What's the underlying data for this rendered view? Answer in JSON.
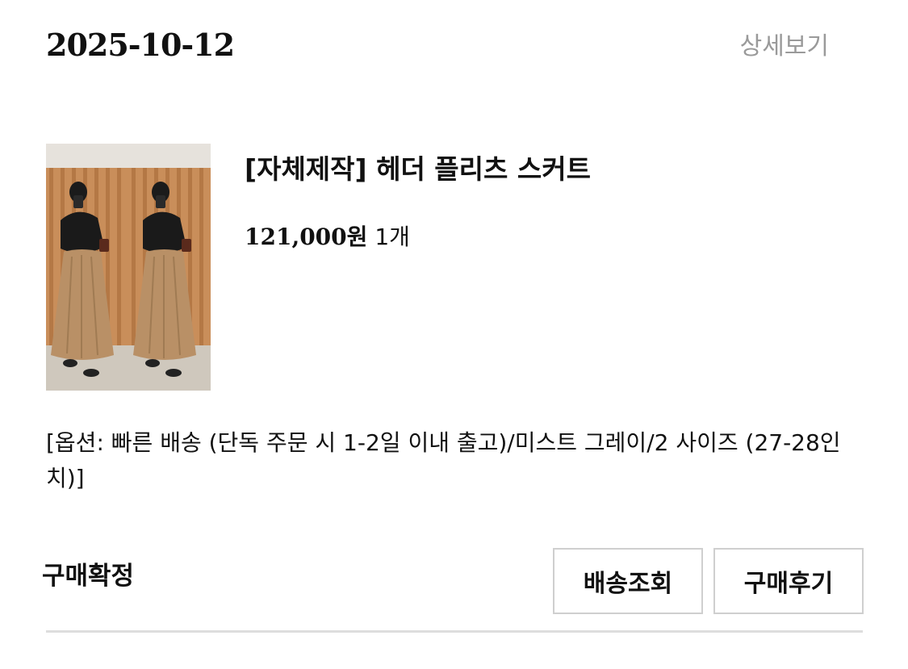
{
  "order": {
    "date": "2025-10-12",
    "detail_link_label": "상세보기",
    "status": "구매확정"
  },
  "product": {
    "name": "[자체제작] 헤더 플리츠 스커트",
    "price": "121,000원",
    "quantity": "1개",
    "option": "[옵션: 빠른 배송 (단독 주문 시 1-2일 이내 출고)/미스트 그레이/2 사이즈 (27-28인치)]"
  },
  "actions": {
    "tracking_label": "배송조회",
    "review_label": "구매후기"
  }
}
